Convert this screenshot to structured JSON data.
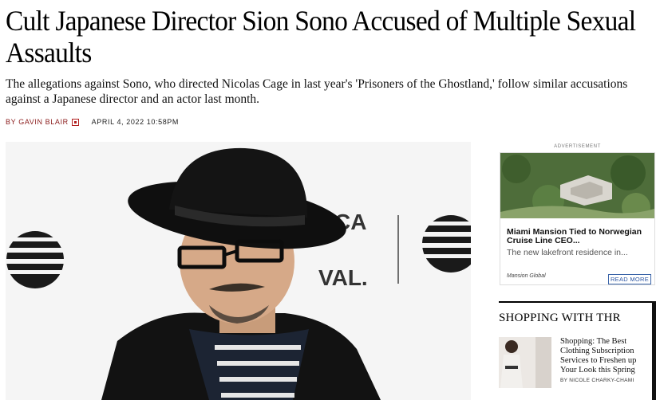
{
  "article": {
    "headline": "Cult Japanese Director Sion Sono Accused of Multiple Sexual Assaults",
    "dek": "The allegations against Sono, who directed Nicolas Cage in last year's 'Prisoners of the Ghostland,' follow similar accusations against a Japanese director and an actor last month.",
    "byline_prefix": "BY",
    "author": "GAVIN BLAIR",
    "date": "APRIL 4, 2022 10:58PM",
    "hero_backdrop_text": {
      "brand_fragment_1": "CA",
      "brand_fragment_2": "VAL."
    }
  },
  "sidebar": {
    "ad": {
      "label": "ADVERTISEMENT",
      "title": "Miami Mansion Tied to Norwegian Cruise Line CEO...",
      "subtitle": "The new lakefront residence in...",
      "source": "Mansion Global",
      "cta": "READ MORE"
    },
    "shopping": {
      "heading": "SHOPPING WITH THR",
      "title": "Shopping: The Best Clothing Subscription Services to Freshen up Your Look this Spring",
      "byline": "BY NICOLE CHARKY-CHAMI"
    }
  },
  "colors": {
    "byline_red": "#8b1c1c",
    "cta_blue": "#2b55a3",
    "hero_background": "#f6f6f6"
  },
  "icons": [
    "author-profile-icon",
    "att-globe-logo"
  ]
}
